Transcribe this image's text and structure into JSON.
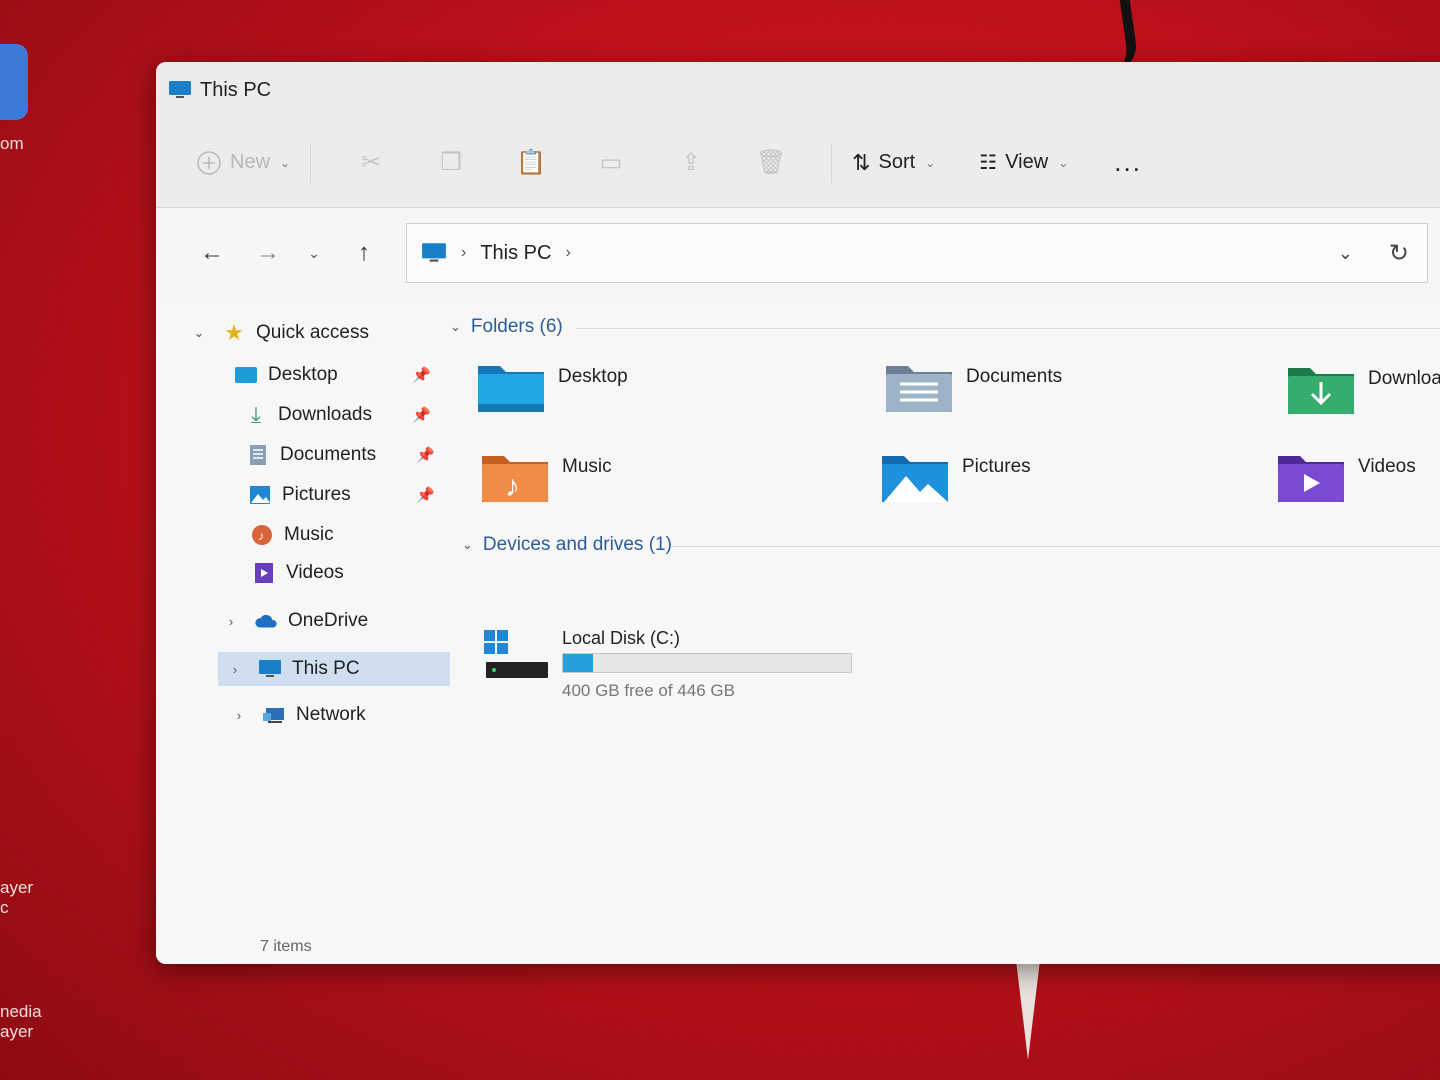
{
  "window": {
    "title": "This PC"
  },
  "toolbar": {
    "new_label": "New",
    "sort_label": "Sort",
    "view_label": "View",
    "more_label": "..."
  },
  "address": {
    "crumbs": [
      "This PC"
    ]
  },
  "sidebar": {
    "items": [
      {
        "label": "Quick access",
        "icon": "star-icon"
      },
      {
        "label": "Desktop",
        "icon": "desktop-folder-icon",
        "pinned": true
      },
      {
        "label": "Downloads",
        "icon": "download-icon",
        "pinned": true
      },
      {
        "label": "Documents",
        "icon": "document-icon",
        "pinned": true
      },
      {
        "label": "Pictures",
        "icon": "pictures-icon",
        "pinned": true
      },
      {
        "label": "Music",
        "icon": "music-icon"
      },
      {
        "label": "Videos",
        "icon": "videos-icon"
      },
      {
        "label": "OneDrive",
        "icon": "cloud-icon"
      },
      {
        "label": "This PC",
        "icon": "computer-icon",
        "selected": true
      },
      {
        "label": "Network",
        "icon": "network-icon"
      }
    ]
  },
  "main": {
    "folders_heading": "Folders (6)",
    "folders": [
      {
        "name": "Desktop",
        "color": "#1e9ad6"
      },
      {
        "name": "Documents",
        "color": "#8aa0b8"
      },
      {
        "name": "Downloa",
        "color": "#2e9e62"
      },
      {
        "name": "Music",
        "color": "#e8843c"
      },
      {
        "name": "Pictures",
        "color": "#1e88d6"
      },
      {
        "name": "Videos",
        "color": "#6a3fbf"
      }
    ],
    "drives_heading": "Devices and drives (1)",
    "drive": {
      "name": "Local Disk (C:)",
      "free_text": "400 GB free of 446 GB",
      "used_fraction": 0.103
    }
  },
  "status": {
    "items_text": "7 items"
  },
  "desktop": {
    "labels": [
      "om",
      "ayer",
      "c",
      "nedia",
      "ayer"
    ]
  },
  "colors": {
    "accent": "#26a0da",
    "selection": "#cfdfef",
    "desktop_bg": "#c1121b"
  }
}
